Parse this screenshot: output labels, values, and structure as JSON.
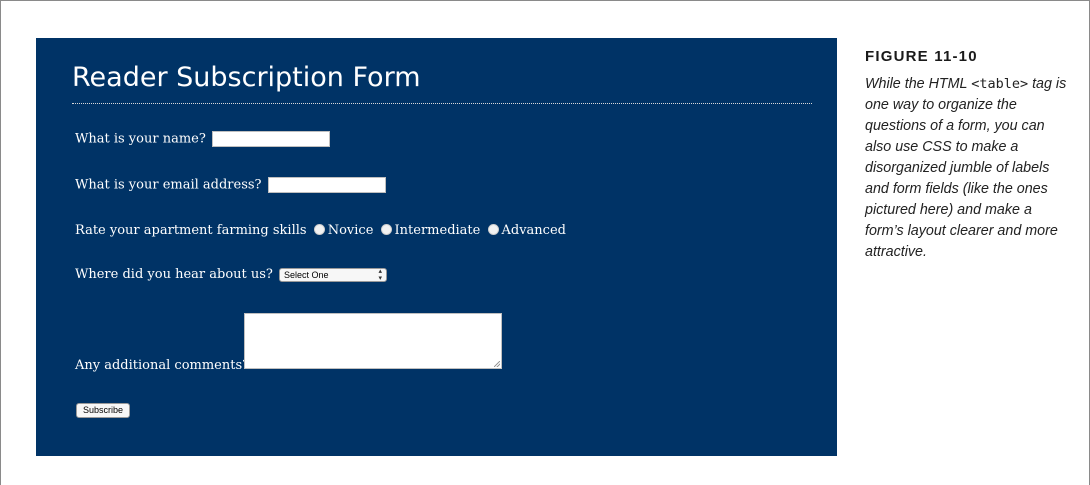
{
  "figure": {
    "label": "FIGURE 11-10",
    "caption_before": "While the HTML ",
    "caption_code": "<table>",
    "caption_after": " tag is one way to organize the questions of a form, you can also use CSS to make a disorganized jumble of labels and form fields (like the ones pictured here) and make a form’s layout clearer and more attractive."
  },
  "form": {
    "title": "Reader Subscription Form",
    "name_label": "What is your name?",
    "name_value": "",
    "email_label": "What is your email address?",
    "email_value": "",
    "skills_label": "Rate your apartment farming skills",
    "skills_options": [
      "Novice",
      "Intermediate",
      "Advanced"
    ],
    "skills_selected": "",
    "referral_label": "Where did you hear about us?",
    "referral_selected": "Select One",
    "comments_label": "Any additional comments?",
    "comments_value": "",
    "submit_label": "Subscribe"
  },
  "colors": {
    "form_background": "#003366",
    "form_text": "#ffffff"
  }
}
